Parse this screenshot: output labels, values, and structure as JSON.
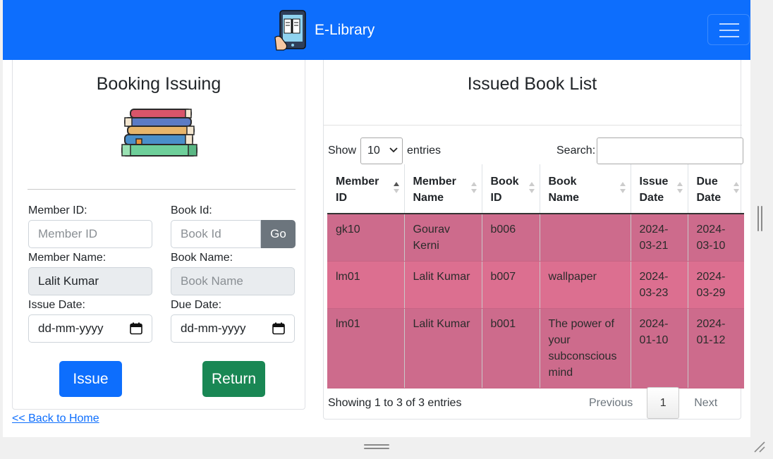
{
  "navbar": {
    "brand": "E-Library",
    "brand_color": "#0d6efd",
    "menu_icon": "hamburger-menu-icon"
  },
  "issuing": {
    "title": "Booking Issuing",
    "image_icon": "book-stack-icon",
    "member_id_label": "Member ID:",
    "member_id_placeholder": "Member ID",
    "member_id_value": "",
    "book_id_label": "Book Id:",
    "book_id_placeholder": "Book Id",
    "book_id_value": "",
    "go_label": "Go",
    "member_name_label": "Member Name:",
    "member_name_value": "Lalit Kumar",
    "book_name_label": "Book Name:",
    "book_name_placeholder": "Book Name",
    "book_name_value": "",
    "issue_date_label": "Issue Date:",
    "issue_date_value": "dd-mm-yyyy",
    "due_date_label": "Due Date:",
    "due_date_value": "dd-mm-yyyy",
    "issue_button": "Issue",
    "return_button": "Return",
    "back_link": "<< Back to Home"
  },
  "issued_list": {
    "title": "Issued Book List",
    "show_label": "Show",
    "entries_label": "entries",
    "page_length": "10",
    "search_label": "Search:",
    "search_value": "",
    "columns": [
      {
        "line1": "Member",
        "line2": "ID"
      },
      {
        "line1": "Member",
        "line2": "Name"
      },
      {
        "line1": "Book",
        "line2": "ID"
      },
      {
        "line1": "Book",
        "line2": "Name"
      },
      {
        "line1": "Issue",
        "line2": "Date"
      },
      {
        "line1": "Due",
        "line2": "Date"
      }
    ],
    "rows": [
      {
        "member_id": "gk10",
        "member_name": "Gourav Kerni",
        "book_id": "b006",
        "book_name": "",
        "issue_date": "2024-03-21",
        "due_date": "2024-03-10"
      },
      {
        "member_id": "lm01",
        "member_name": "Lalit Kumar",
        "book_id": "b007",
        "book_name": "wallpaper",
        "issue_date": "2024-03-23",
        "due_date": "2024-03-29"
      },
      {
        "member_id": "lm01",
        "member_name": "Lalit Kumar",
        "book_id": "b001",
        "book_name": "The power of your subconscious mind",
        "issue_date": "2024-01-10",
        "due_date": "2024-01-12"
      }
    ],
    "info": "Showing 1 to 3 of 3 entries",
    "previous": "Previous",
    "page": "1",
    "next": "Next",
    "row_color_odd": "#cd6b8c",
    "row_color_even": "#dc6f90"
  }
}
